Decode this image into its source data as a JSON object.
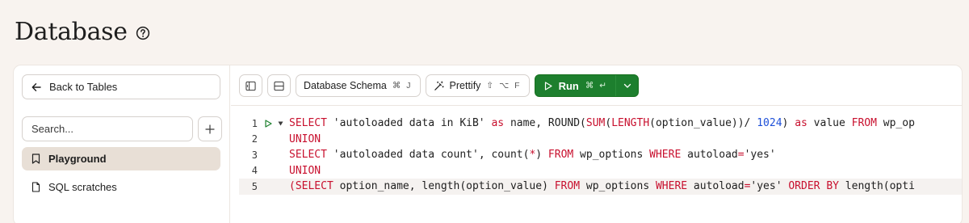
{
  "page": {
    "title": "Database",
    "help_icon": "question-circle-icon"
  },
  "sidebar": {
    "back_label": "Back to Tables",
    "search_placeholder": "Search...",
    "items": [
      {
        "label": "Playground",
        "icon": "bookmark-icon",
        "active": true
      },
      {
        "label": "SQL scratches",
        "icon": "file-icon",
        "active": false
      }
    ]
  },
  "toolbar": {
    "schema_label": "Database Schema",
    "schema_shortcut": "⌘ J",
    "prettify_label": "Prettify",
    "prettify_shortcut": "⇧ ⌥ F",
    "run_label": "Run",
    "run_shortcut": "⌘ ↵"
  },
  "editor": {
    "lines": [
      {
        "number": "1",
        "text": "SELECT 'autoloaded data in KiB' as name, ROUND(SUM(LENGTH(option_value))/ 1024) as value FROM wp_op"
      },
      {
        "number": "2",
        "text": "UNION"
      },
      {
        "number": "3",
        "text": "SELECT 'autoloaded data count', count(*) FROM wp_options WHERE autoload='yes'"
      },
      {
        "number": "4",
        "text": "UNION"
      },
      {
        "number": "5",
        "text": "(SELECT option_name, length(option_value) FROM wp_options WHERE autoload='yes' ORDER BY length(opti"
      }
    ]
  },
  "colors": {
    "background": "#f8f3ef",
    "run_button": "#1d7f2e",
    "keyword": "#c8102e",
    "number": "#1d4fd8",
    "active_item": "#e8dfd6"
  }
}
